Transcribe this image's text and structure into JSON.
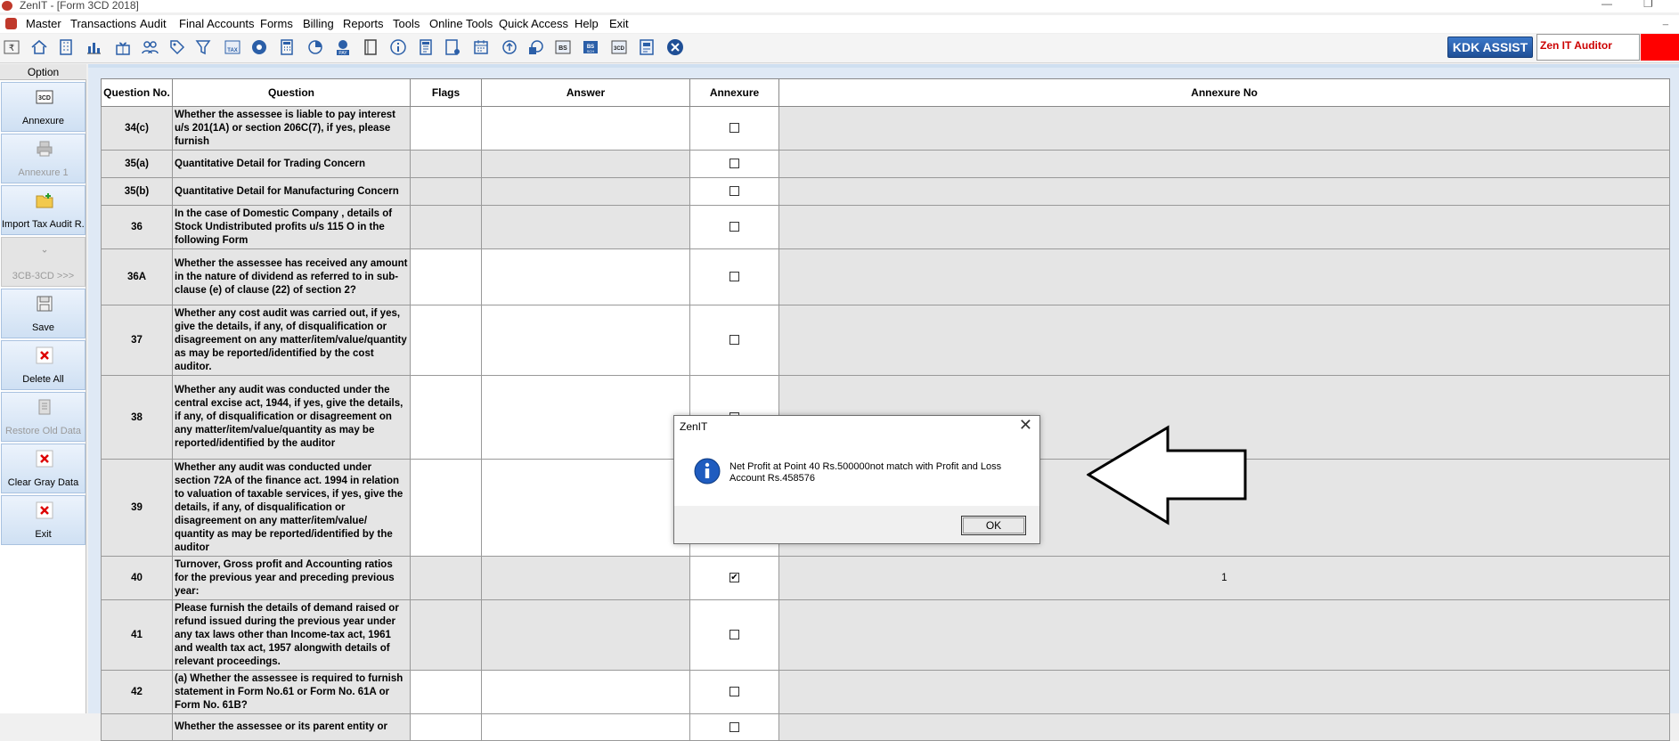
{
  "window": {
    "title": "ZenIT - [Form 3CD 2018]"
  },
  "menu": [
    "Master",
    "Transactions",
    "Audit",
    "Final Accounts",
    "Forms",
    "Billing",
    "Reports",
    "Tools",
    "Online Tools",
    "Quick Access",
    "Help",
    "Exit"
  ],
  "toolbar": {
    "icons": [
      "rupee-icon",
      "home-icon",
      "building-icon",
      "bar-chart-icon",
      "gift-icon",
      "users-icon",
      "tag-icon",
      "filter-icon",
      "tax-icon",
      "eye-icon",
      "calculator-icon",
      "pie-chart-icon",
      "pay-icon",
      "book-icon",
      "info-icon",
      "document-icon",
      "form-icon",
      "calendar-icon",
      "upload-icon",
      "image-icon",
      "bs-icon",
      "bs-sch-icon",
      "3cd-icon",
      "report-icon",
      "close-circle-icon"
    ],
    "kdk_assist": "KDK ASSIST",
    "auditor_name": "Zen IT Auditor"
  },
  "sidebar": {
    "header": "Option",
    "buttons": [
      {
        "label": "Annexure",
        "icon": "3cd-icon",
        "enabled": true
      },
      {
        "label": "Annexure 1",
        "icon": "printer-icon",
        "enabled": false
      },
      {
        "label": "Import Tax Audit R...",
        "icon": "folder-add-icon",
        "enabled": true
      },
      {
        "label": "3CB-3CD >>>",
        "icon": "chevron-down-icon",
        "enabled": false
      },
      {
        "label": "Save",
        "icon": "save-icon",
        "enabled": true
      },
      {
        "label": "Delete All",
        "icon": "delete-icon",
        "enabled": true
      },
      {
        "label": "Restore Old Data",
        "icon": "restore-icon",
        "enabled": false
      },
      {
        "label": "Clear Gray Data",
        "icon": "delete-icon",
        "enabled": true
      },
      {
        "label": "Exit",
        "icon": "exit-icon",
        "enabled": true
      }
    ]
  },
  "grid": {
    "columns": [
      "Question No.",
      "Question",
      "Flags",
      "Answer",
      "Annexure",
      "Annexure No"
    ],
    "rows": [
      {
        "no": "34(c)",
        "question": "Whether the assessee is liable to pay interest u/s 201(1A) or section 206C(7), if yes, please furnish",
        "annexure_checked": false,
        "annexure_no": "",
        "white": true
      },
      {
        "no": "35(a)",
        "question": "Quantitative Detail for Trading Concern",
        "annexure_checked": false,
        "annexure_no": "",
        "white": false
      },
      {
        "no": "35(b)",
        "question": "Quantitative Detail for Manufacturing Concern",
        "annexure_checked": false,
        "annexure_no": "",
        "white": false
      },
      {
        "no": "36",
        "question": "In the case of Domestic Company , details of Stock Undistributed profits u/s 115 O in the following Form",
        "annexure_checked": false,
        "annexure_no": "",
        "white": false
      },
      {
        "no": "36A",
        "question": "Whether the assessee has received any amount in the nature of dividend as referred to in sub-clause (e) of clause (22) of section 2?",
        "annexure_checked": false,
        "annexure_no": "",
        "white": true
      },
      {
        "no": "37",
        "question": "Whether any cost audit was carried out, if yes, give the details, if any, of disqualification or disagreement on any matter/item/value/quantity as may be reported/identified by the cost auditor.",
        "annexure_checked": false,
        "annexure_no": "",
        "white": true
      },
      {
        "no": "38",
        "question": "Whether any audit was conducted under the central excise act, 1944, if yes, give the details, if any, of disqualification or disagreement on any matter/item/value/quantity as may be reported/identified by the auditor",
        "annexure_checked": false,
        "annexure_no": "",
        "white": true
      },
      {
        "no": "39",
        "question": "Whether any audit was conducted under section 72A of the finance act. 1994 in relation to valuation of taxable services, if yes, give the details, if any, of disqualification or disagreement on any matter/item/value/ quantity as may be reported/identified by the auditor",
        "annexure_checked": false,
        "annexure_no": "",
        "white": true
      },
      {
        "no": "40",
        "question": "Turnover, Gross profit and Accounting ratios for the previous year and preceding previous year:",
        "annexure_checked": true,
        "annexure_no": "1",
        "white": false
      },
      {
        "no": "41",
        "question": "Please furnish the details of demand raised or refund issued during the previous year under any tax laws other than Income-tax act, 1961 and wealth tax act, 1957 alongwith details of relevant proceedings.",
        "annexure_checked": false,
        "annexure_no": "",
        "white": false
      },
      {
        "no": "42",
        "question": "(a) Whether the assessee is required to furnish statement in Form No.61 or Form No. 61A or Form No. 61B?",
        "annexure_checked": false,
        "annexure_no": "",
        "white": true
      },
      {
        "no": "",
        "question": "Whether the assessee or its parent entity or",
        "annexure_checked": false,
        "annexure_no": "",
        "white": true
      }
    ]
  },
  "dialog": {
    "title": "ZenIT",
    "message": "Net Profit at Point 40 Rs.500000not match with Profit and Loss Account Rs.458576",
    "ok_label": "OK"
  }
}
